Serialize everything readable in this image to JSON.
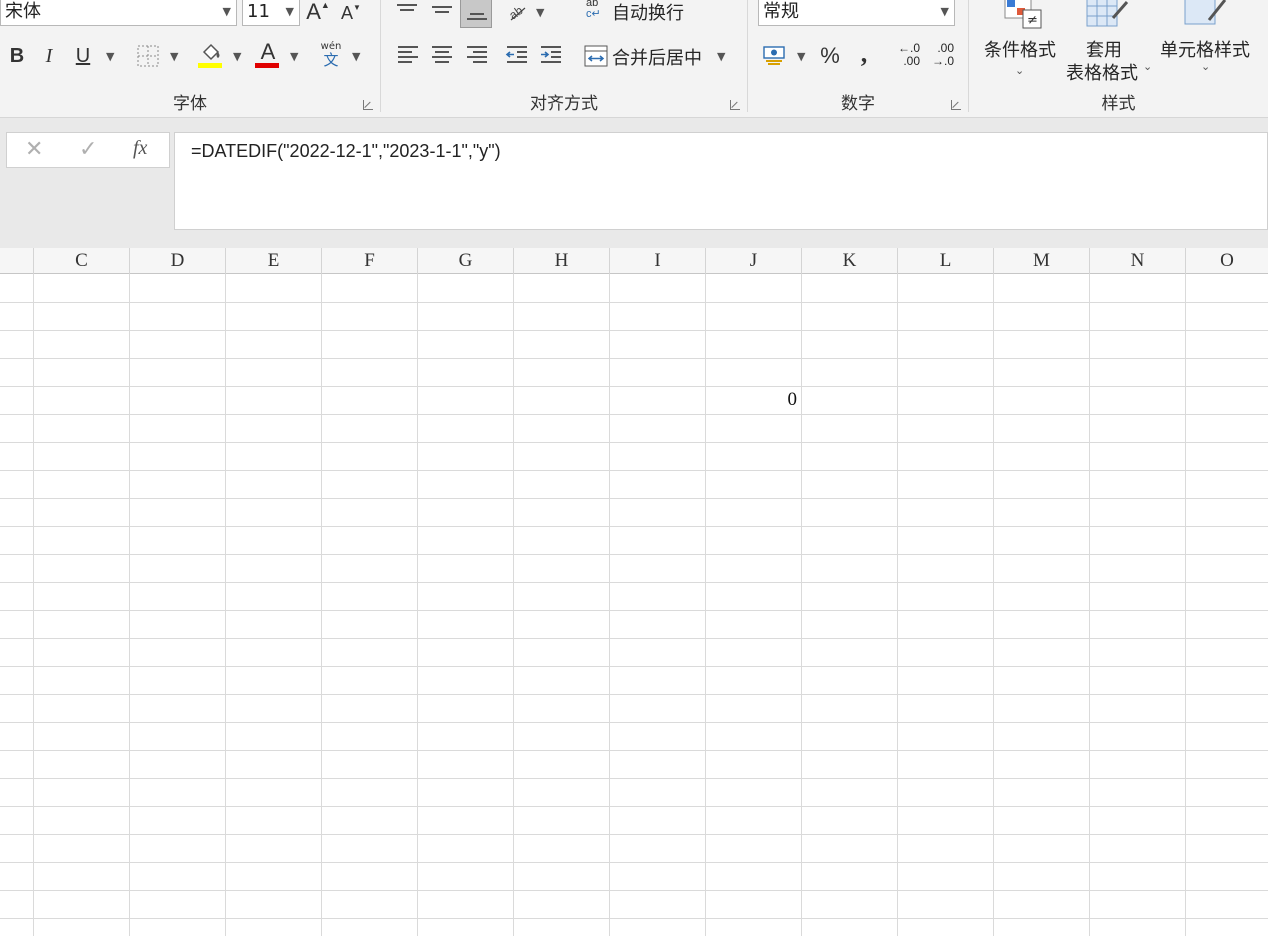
{
  "ribbon": {
    "font": {
      "name": "宋体",
      "size": "11",
      "group_label": "字体",
      "bold": "B",
      "italic": "I",
      "underline": "U",
      "grow": "A",
      "shrink": "A",
      "phonetic_top": "wén",
      "phonetic_bottom": "文",
      "highlight_color": "#ffff00",
      "font_color": "#e00000"
    },
    "alignment": {
      "group_label": "对齐方式",
      "wrap_text": "自动换行",
      "merge_center": "合并后居中",
      "wrap_icon_text": "ab"
    },
    "number": {
      "group_label": "数字",
      "format": "常规",
      "percent": "%",
      "comma": ",",
      "inc_decimal_top": "←.0",
      "inc_decimal_bottom": ".00",
      "dec_decimal_top": ".00",
      "dec_decimal_bottom": "→.0"
    },
    "styles": {
      "group_label": "样式",
      "conditional_format": "条件格式",
      "format_as_table_line1": "套用",
      "format_as_table_line2": "表格格式",
      "cell_styles": "单元格样式"
    }
  },
  "formula_bar": {
    "cancel": "✕",
    "enter": "✓",
    "fx": "fx",
    "formula": "=DATEDIF(\"2022-12-1\",\"2023-1-1\",\"y\")"
  },
  "sheet": {
    "columns": [
      "C",
      "D",
      "E",
      "F",
      "G",
      "H",
      "I",
      "J",
      "K",
      "L",
      "M",
      "N",
      "O"
    ],
    "cells": [
      {
        "column": "J",
        "value": "0"
      }
    ]
  }
}
